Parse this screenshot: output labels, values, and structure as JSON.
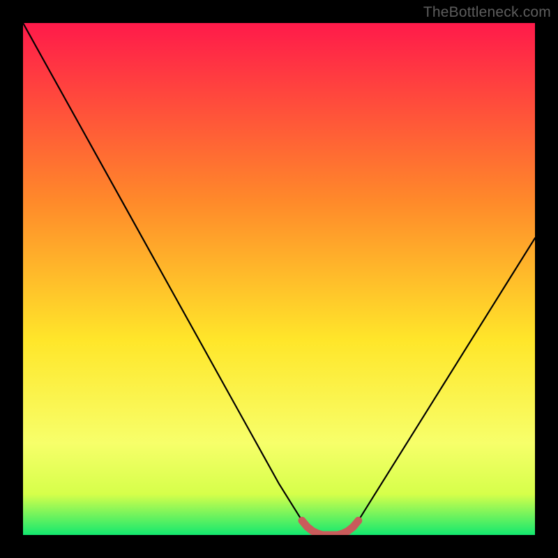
{
  "watermark": "TheBottleneck.com",
  "colors": {
    "gradient_top": "#ff1a4a",
    "gradient_mid1": "#ff8a2a",
    "gradient_mid2": "#ffe62a",
    "gradient_low": "#f7ff6a",
    "gradient_bottom_band_top": "#d6ff4a",
    "gradient_bottom": "#13e86f",
    "curve": "#000000",
    "marker_stroke": "#c95b5b",
    "marker_fill": "rgba(201,91,91,0.85)"
  },
  "chart_data": {
    "type": "line",
    "x": [
      0.0,
      0.05,
      0.1,
      0.15,
      0.2,
      0.25,
      0.3,
      0.35,
      0.4,
      0.45,
      0.5,
      0.55,
      0.575,
      0.6,
      0.625,
      0.65,
      0.7,
      0.75,
      0.8,
      0.85,
      0.9,
      0.95,
      1.0
    ],
    "values": [
      1.0,
      0.91,
      0.82,
      0.73,
      0.64,
      0.55,
      0.46,
      0.37,
      0.28,
      0.19,
      0.1,
      0.02,
      0.0,
      0.0,
      0.0,
      0.02,
      0.1,
      0.18,
      0.26,
      0.34,
      0.42,
      0.5,
      0.58
    ],
    "ylim": [
      0,
      1
    ],
    "xlim": [
      0,
      1
    ],
    "title": "",
    "xlabel": "",
    "ylabel": "",
    "marker_segment": {
      "x": [
        0.545,
        0.555,
        0.565,
        0.575,
        0.585,
        0.595,
        0.605,
        0.615,
        0.625,
        0.635,
        0.645,
        0.655
      ],
      "values": [
        0.028,
        0.016,
        0.008,
        0.003,
        0.0,
        0.0,
        0.0,
        0.0,
        0.003,
        0.008,
        0.016,
        0.028
      ]
    }
  }
}
